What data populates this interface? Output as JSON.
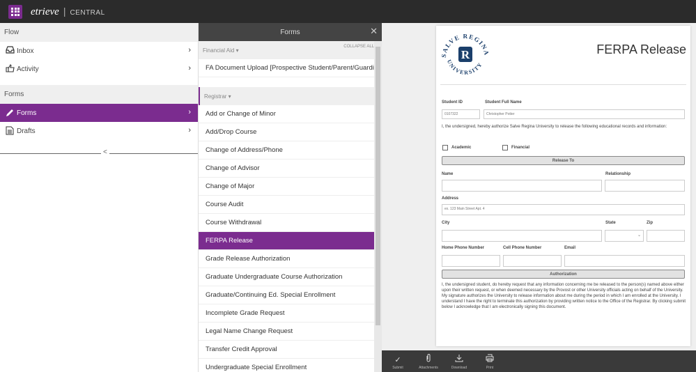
{
  "brand": {
    "logo": "etrieve",
    "separator": "|",
    "app": "CENTRAL"
  },
  "leftnav": {
    "flow_header": "Flow",
    "flow_items": [
      {
        "label": "Inbox",
        "icon": "inbox-icon"
      },
      {
        "label": "Activity",
        "icon": "activity-icon"
      }
    ],
    "forms_header": "Forms",
    "forms_items": [
      {
        "label": "Forms",
        "icon": "pencil-icon",
        "active": true
      },
      {
        "label": "Drafts",
        "icon": "document-icon"
      }
    ],
    "collapse_glyph": "<"
  },
  "formspanel": {
    "title": "Forms",
    "close_glyph": "✕",
    "collapse_all": "COLLAPSE ALL",
    "categories": [
      {
        "label": "Financial Aid ▾",
        "items": [
          "FA Document Upload [Prospective Student/Parent/Guardi..."
        ]
      },
      {
        "label": "Registrar ▾",
        "items": [
          "Add or Change of Minor",
          "Add/Drop Course",
          "Change of Address/Phone",
          "Change of Advisor",
          "Change of Major",
          "Course Audit",
          "Course Withdrawal",
          "FERPA Release",
          "Grade Release Authorization",
          "Graduate Undergraduate Course Authorization",
          "Graduate/Continuing Ed. Special Enrollment",
          "Incomplete Grade Request",
          "Legal Name Change Request",
          "Transfer Credit Approval",
          "Undergraduate Special Enrollment"
        ]
      }
    ],
    "active_item": "FERPA Release"
  },
  "document": {
    "seal_text_top": "SALVE REGINA",
    "seal_text_bottom": "UNIVERSITY",
    "seal_letter": "R",
    "title": "FERPA Release",
    "student_id_label": "Student ID",
    "student_id_value": "0107322",
    "student_name_label": "Student Full Name",
    "student_name_value": "Christopher Potter",
    "authorize_text": "I, the undersigned, hereby authorize Salve Regina University to release the following educational records and information:",
    "academic_label": "Academic",
    "financial_label": "Financial",
    "release_to_bar": "Release To",
    "name_label": "Name",
    "relationship_label": "Relationship",
    "address_label": "Address",
    "address_placeholder": "ex. 123 Main Street Apt. 4",
    "city_label": "City",
    "state_label": "State",
    "zip_label": "Zip",
    "home_phone_label": "Home Phone Number",
    "cell_phone_label": "Cell Phone Number",
    "email_label": "Email",
    "authorization_bar": "Authorization",
    "authorization_text": "I, the undersigned student, do hereby request that any information concerning me be released to the person(s) named above either upon their written request, or when deemed necessary by the Provost or other University officials acting on behalf of the University. My signature authorizes the University to release information about me during the period in which I am enrolled at the University. I understand I have the right to terminate this authorization by providing written notice to the Office of the Registrar. By clicking submit below I acknowledge that I am electronically signing this document."
  },
  "toolbar": {
    "buttons": [
      {
        "label": "Submit",
        "icon": "check-icon"
      },
      {
        "label": "Attachments",
        "icon": "paperclip-icon"
      },
      {
        "label": "Download",
        "icon": "download-icon"
      },
      {
        "label": "Print",
        "icon": "printer-icon"
      }
    ]
  }
}
